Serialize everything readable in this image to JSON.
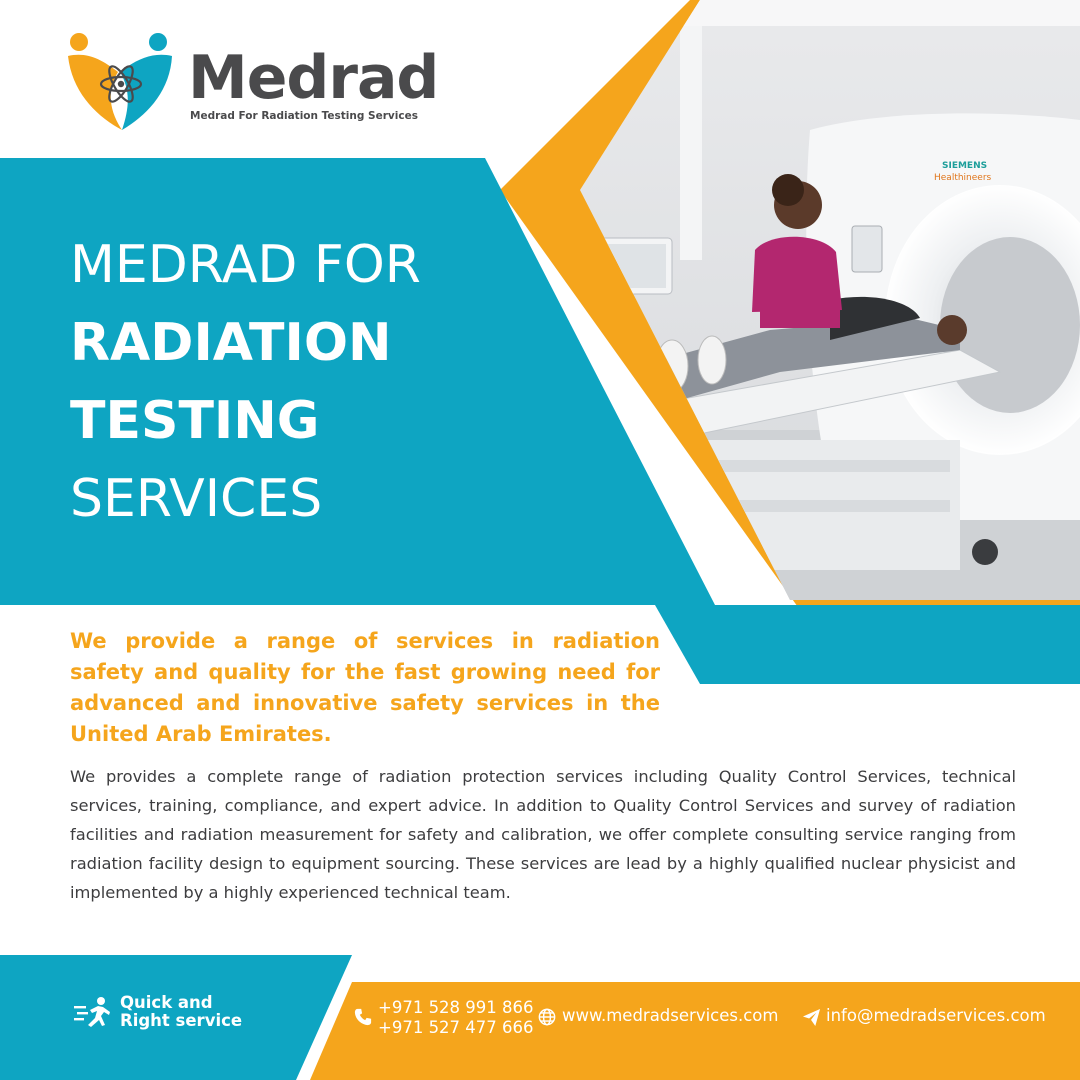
{
  "brand": {
    "name": "Medrad",
    "tagline": "Medrad For Radiation Testing Services",
    "logo_icon": "atom-people-heart-logo"
  },
  "headline": {
    "line1": "MEDRAD FOR",
    "line2": "RADIATION",
    "line3": "TESTING",
    "line4": "SERVICES"
  },
  "lead": "We provide a range of services in radiation safety and quality for the fast growing need for advanced and innovative safety services in the United Arab Emirates.",
  "body": "We provides a complete range of radiation protection services including Quality Control Services, technical services, training, compliance, and expert advice. In addition to Quality Control Services and survey of radiation facilities and radiation measurement for safety and calibration, we offer complete consulting service ranging from radiation facility design to equipment sourcing. These services are lead by a highly qualified nuclear physicist and implemented by a highly experienced technical team.",
  "photo": {
    "machine_brand_line1": "SIEMENS",
    "machine_brand_line2": "Healthineers"
  },
  "footer": {
    "quick_line1": "Quick and",
    "quick_line2": "Right service",
    "quick_icon": "running-person-icon",
    "phone1": "+971 528 991 866",
    "phone2": "+971 527 477 666",
    "phone_icon": "phone-icon",
    "website": "www.medradservices.com",
    "website_icon": "globe-icon",
    "email": "info@medradservices.com",
    "email_icon": "paper-plane-icon"
  },
  "colors": {
    "teal": "#0ea5c2",
    "orange": "#f5a51c",
    "dark_grey": "#4a4a4c",
    "white": "#ffffff"
  }
}
